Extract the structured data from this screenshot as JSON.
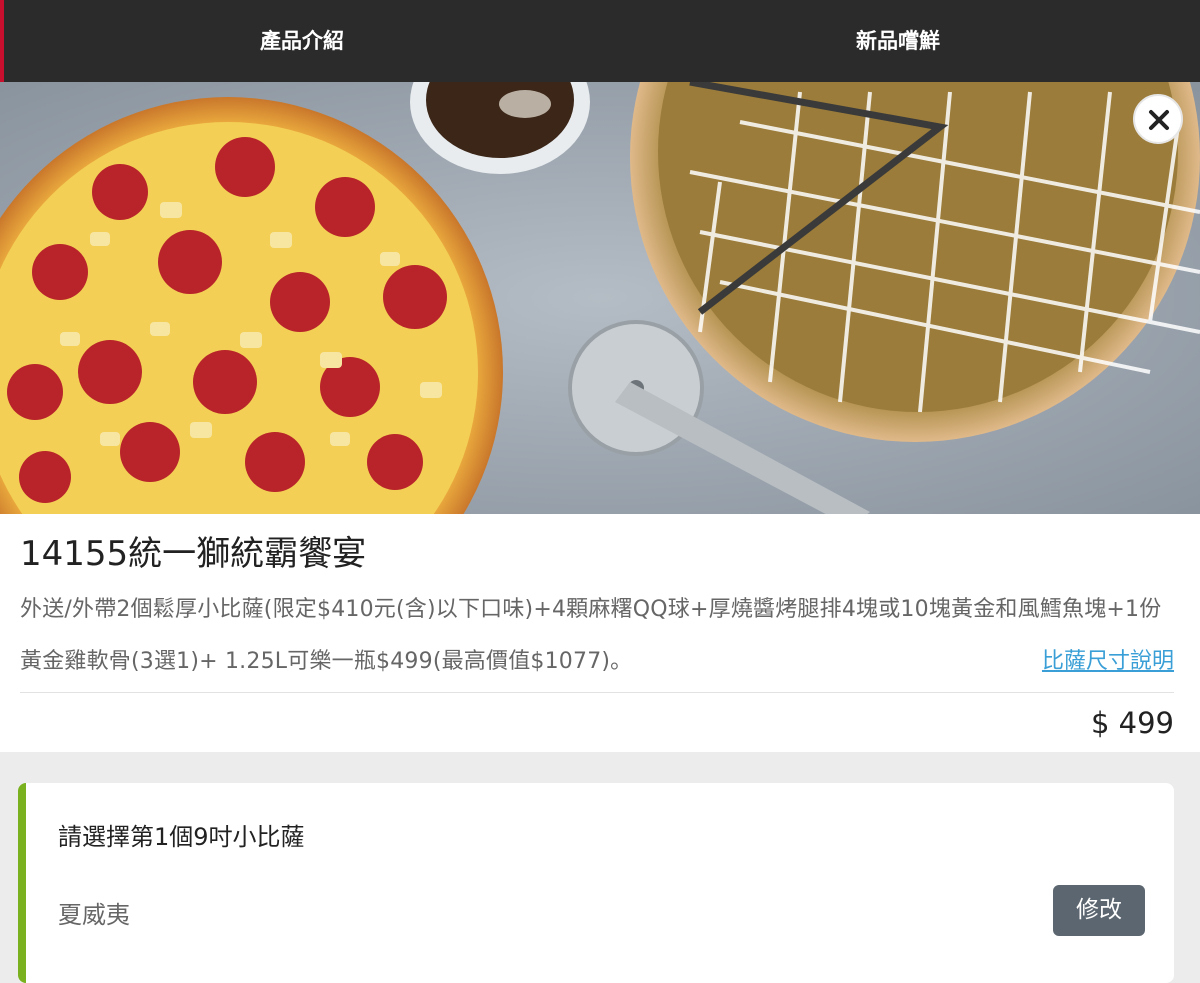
{
  "nav": {
    "tabs": [
      {
        "label": "產品介紹"
      },
      {
        "label": "新品嚐鮮"
      }
    ],
    "accent_color": "#c8102e"
  },
  "hero": {
    "close_icon": "close-icon"
  },
  "product": {
    "title": "14155統一獅統霸饗宴",
    "description": "外送/外帶2個鬆厚小比薩(限定$410元(含)以下口味)+4顆麻糬QQ球+厚燒醬烤腿排4塊或10塊黃金和風鱈魚塊+1份黃金雞軟骨(3選1)+ 1.25L可樂一瓶$499(最高價值$1077)。",
    "size_link": "比薩尺寸說明",
    "price": "$ 499",
    "link_color": "#3a9fd6"
  },
  "option": {
    "heading": "請選擇第1個9吋小比薩",
    "selected_value": "夏威夷",
    "modify_label": "修改",
    "accent_color": "#79b21e"
  }
}
